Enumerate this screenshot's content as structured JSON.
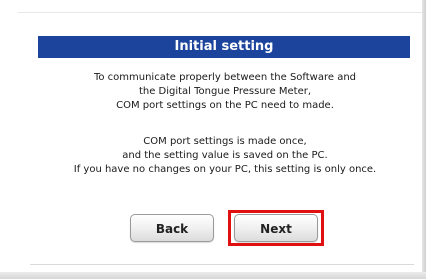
{
  "dialog": {
    "title": "Initial setting",
    "paragraph1": [
      "To communicate properly between the Software and",
      "the Digital Tongue Pressure Meter,",
      "COM port settings on the PC need to made."
    ],
    "paragraph2": [
      "COM port settings is made once,",
      "and the setting value is saved on the PC.",
      "If you have no changes on your PC, this setting is only once."
    ]
  },
  "buttons": {
    "back_label": "Back",
    "next_label": "Next"
  },
  "colors": {
    "title_bar": "#1c449c",
    "highlight": "#e01010"
  }
}
